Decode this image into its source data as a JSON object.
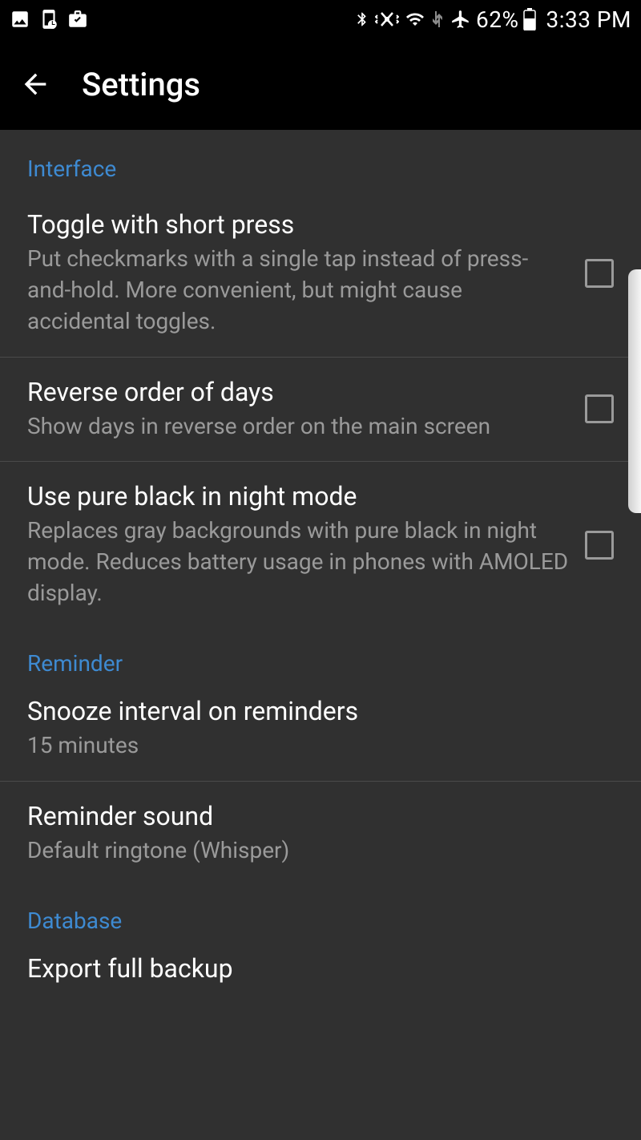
{
  "status_bar": {
    "battery_percent": "62%",
    "time": "3:33 PM"
  },
  "toolbar": {
    "title": "Settings"
  },
  "sections": {
    "interface": {
      "header": "Interface",
      "items": [
        {
          "title": "Toggle with short press",
          "subtitle": "Put checkmarks with a single tap instead of press-and-hold. More convenient, but might cause accidental toggles.",
          "checked": false
        },
        {
          "title": "Reverse order of days",
          "subtitle": "Show days in reverse order on the main screen",
          "checked": false
        },
        {
          "title": "Use pure black in night mode",
          "subtitle": "Replaces gray backgrounds with pure black in night mode. Reduces battery usage in phones with AMOLED display.",
          "checked": false
        }
      ]
    },
    "reminder": {
      "header": "Reminder",
      "items": [
        {
          "title": "Snooze interval on reminders",
          "subtitle": "15 minutes"
        },
        {
          "title": "Reminder sound",
          "subtitle": "Default ringtone (Whisper)"
        }
      ]
    },
    "database": {
      "header": "Database",
      "items": [
        {
          "title": "Export full backup"
        }
      ]
    }
  }
}
